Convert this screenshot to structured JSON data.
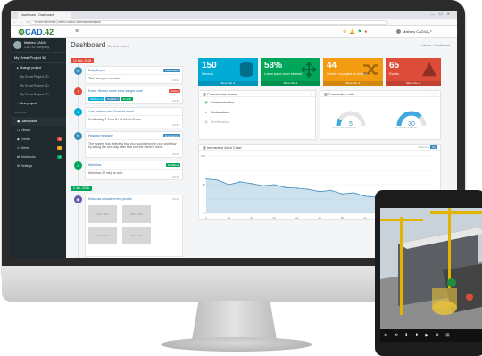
{
  "browser": {
    "tab_title": "Dashboard - Dashboard",
    "window_controls": "— ☐ ✕",
    "url": "① Non sécurisé | demo.cad42.com/dashboard/#"
  },
  "header": {
    "logo_main": "CAD",
    "logo_accent": ".42",
    "user_name": "Mathieu CAD42",
    "icons": [
      "gear-icon",
      "bell-icon",
      "flag-icon",
      "user-icon",
      "expand-icon"
    ]
  },
  "sidebar": {
    "user_name": "Mathieu CAD42",
    "company": "CAD 42 company",
    "project": "My Great Project 3D",
    "change_project": "Change project",
    "projects": [
      "My Great Project 3D",
      "My Great Project 2D",
      "My Great Project 4D"
    ],
    "new_project": "New project",
    "section_label": "Navigation",
    "items": [
      {
        "label": "Dashboard",
        "badge": ""
      },
      {
        "label": "Viewer",
        "badge": ""
      },
      {
        "label": "Events",
        "badge": "8"
      },
      {
        "label": "Alerts",
        "badge": "3"
      },
      {
        "label": "Workflows",
        "badge": "2"
      },
      {
        "label": "Settings",
        "badge": ""
      }
    ]
  },
  "main": {
    "title": "Dashboard",
    "subtitle": "Control panel",
    "breadcrumb": "⌂ Home › Dashboard"
  },
  "timeline": {
    "dates": [
      "10 Feb. 2018",
      "3 Jan. 2018"
    ],
    "entries": [
      {
        "title": "Daily Report",
        "tag": "Dashboard",
        "body": "This area you can track",
        "time": "09:30"
      },
      {
        "title": "Event: Worker name zone danger zone",
        "tag": "Safety",
        "body": "",
        "time": "09:30"
      },
      {
        "title": "Lina added a new Scaffold event",
        "tag": "",
        "body": "Scaffolding 3 Zone B Lot Wood Floors",
        "time": "09:30"
      },
      {
        "title": "Hospital message",
        "tag": "Emergency",
        "body": "The system has detected that you would improve your workflow by taking the next day after that and the client is done.",
        "time": "09:30"
      },
      {
        "title": "Workflow",
        "tag": "Workflow",
        "body": "Workflow 22 step to do it",
        "time": "09:30"
      },
      {
        "title": "Mina has uploaded new photos",
        "tag": "",
        "body": "",
        "time": "09:30"
      }
    ],
    "chips": [
      "Workers 12",
      "Scaffold 4",
      "Zone B"
    ],
    "photo_label": "300 × 200"
  },
  "stats": [
    {
      "value": "150",
      "label": "Sensors",
      "footer": "More info ➜",
      "color": "#00acd6"
    },
    {
      "value": "53%",
      "label": "Lorem ipsum dolor sit amet",
      "footer": "More info ➜",
      "color": "#00a65a"
    },
    {
      "value": "44",
      "label": "Check in a project for workers",
      "footer": "More info ➜",
      "color": "#f39c12"
    },
    {
      "value": "65",
      "label": "Events",
      "footer": "More info ➜",
      "color": "#dd4b39"
    }
  ],
  "connections": {
    "title": "Connections status",
    "rows": [
      {
        "label": "Communication",
        "icon": "wifi-icon",
        "color": "#2e9e4f"
      },
      {
        "label": "Geolocation",
        "icon": "location-icon",
        "color": "#d9534f"
      },
      {
        "label": "Identification",
        "icon": "id-icon",
        "color": "#b0b0b0"
      }
    ]
  },
  "units": {
    "title": "Connected units",
    "gauges": [
      {
        "value": "5",
        "label": "Connected sensors",
        "fraction": 0.17
      },
      {
        "value": "30",
        "label": "Connected tablets",
        "fraction": 0.75
      }
    ]
  },
  "chart": {
    "title": "Interactive Area Chart",
    "realtime_label": "Real time",
    "toggle": "On"
  },
  "chart_data": {
    "type": "area",
    "title": "Interactive Area Chart",
    "x": [
      0,
      5,
      10,
      15,
      20,
      25,
      30,
      35,
      40,
      45,
      50,
      55,
      60,
      65,
      70,
      75,
      80,
      85,
      90,
      95,
      100
    ],
    "values": [
      60,
      58,
      50,
      55,
      52,
      48,
      50,
      45,
      44,
      42,
      38,
      40,
      34,
      36,
      30,
      28,
      25,
      22,
      18,
      14,
      10
    ],
    "xlim": [
      0,
      100
    ],
    "ylim": [
      0,
      100
    ],
    "color": "#3c8dbc"
  },
  "tablet": {
    "toolbar": "⊕ ⟲ ⬇ ⬆ ▶ ⚙ ⊞"
  }
}
